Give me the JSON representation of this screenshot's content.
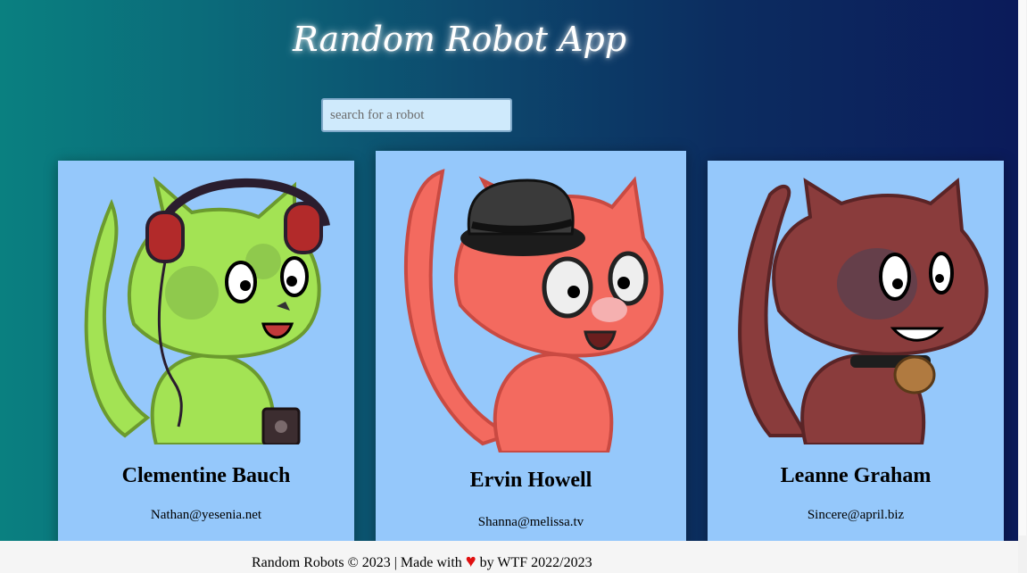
{
  "header": {
    "title": "Random Robot App"
  },
  "search": {
    "placeholder": "search for a robot",
    "value": ""
  },
  "cards": [
    {
      "name": "Clementine Bauch",
      "email": "Nathan@yesenia.net",
      "color": "#a3e354",
      "accessory": "headphones-icon"
    },
    {
      "name": "Ervin Howell",
      "email": "Shanna@melissa.tv",
      "color": "#f36a5f",
      "accessory": "top-hat-icon"
    },
    {
      "name": "Leanne Graham",
      "email": "Sincere@april.biz",
      "color": "#8a3c3c",
      "accessory": "microphone-icon"
    }
  ],
  "footer": {
    "prefix": "Random Robots © 2023 | Made with",
    "heart": "♥",
    "suffix": "by WTF 2022/2023"
  },
  "colors": {
    "card_bg": "#95c8fb",
    "search_bg": "#cfeafc",
    "footer_bg": "#f5f5f5",
    "heart": "#e01010"
  }
}
